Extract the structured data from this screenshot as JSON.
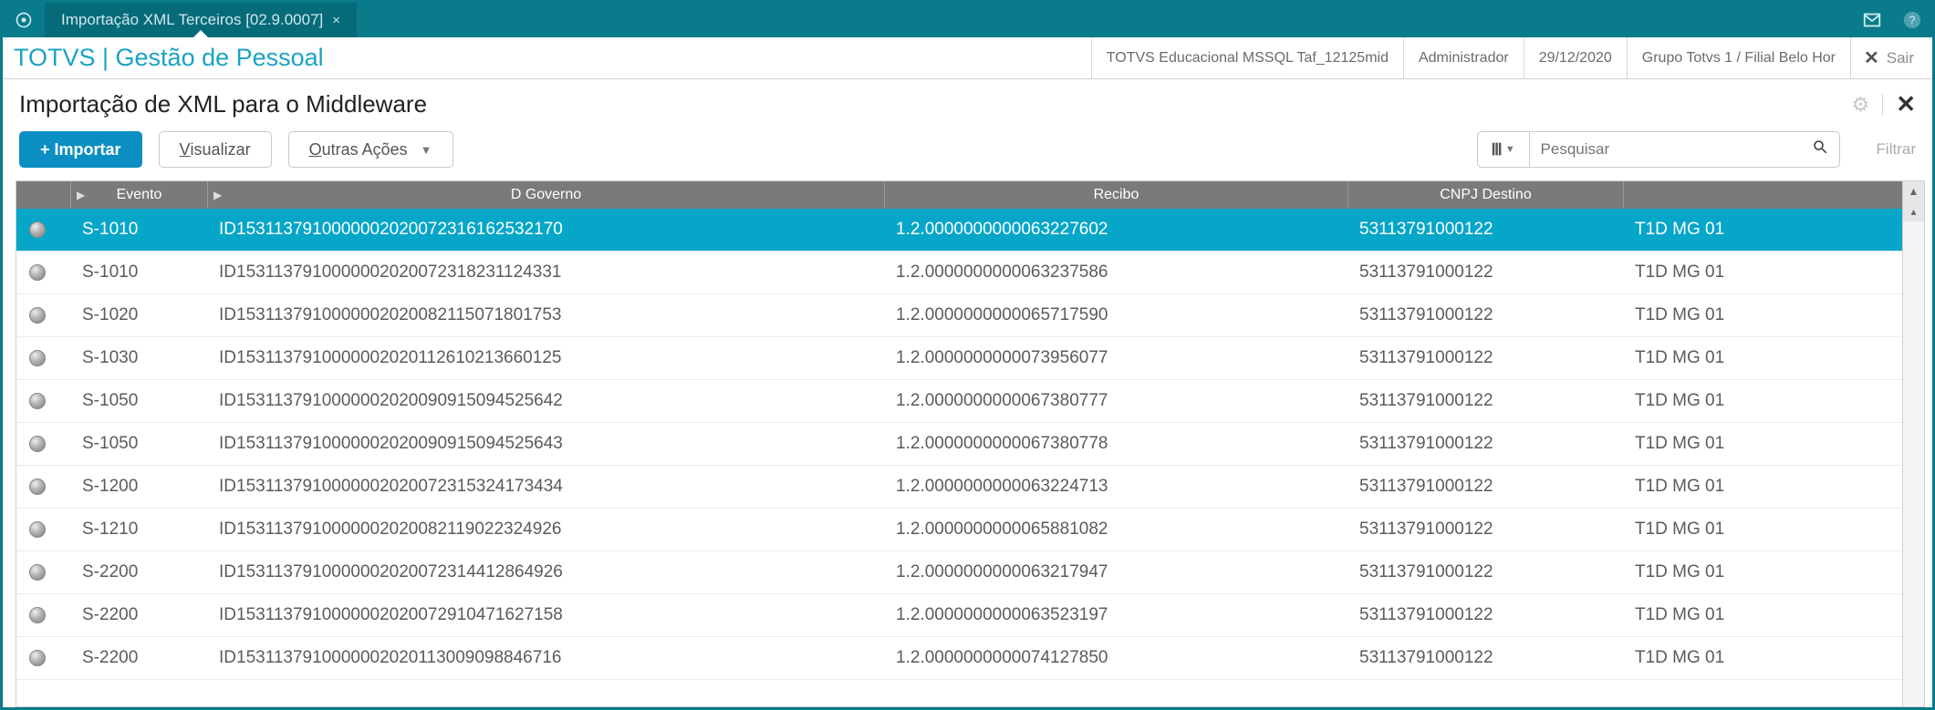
{
  "titlebar": {
    "tab_label": "Importação XML Terceiros [02.9.0007]"
  },
  "modulebar": {
    "title": "TOTVS | Gestão de Pessoal",
    "crumbs": [
      "TOTVS Educacional MSSQL Taf_12125mid",
      "Administrador",
      "29/12/2020",
      "Grupo Totvs 1 / Filial Belo Hor"
    ],
    "exit_label": "Sair"
  },
  "page": {
    "title": "Importação de XML para o Middleware"
  },
  "toolbar": {
    "import_label": "+ Importar",
    "visualizar_u": "V",
    "visualizar_rest": "isualizar",
    "outras_u": "O",
    "outras_rest": "utras Ações",
    "search_placeholder": "Pesquisar",
    "filtrar_label": "Filtrar"
  },
  "columns": {
    "evento": "Evento",
    "gov": "D Governo",
    "recibo": "Recibo",
    "cnpj": "CNPJ Destino"
  },
  "rows": [
    {
      "evento": "S-1010",
      "gov": "ID1531137910000002020072316162532170",
      "recibo": "1.2.0000000000063227602",
      "cnpj": "53113791000122",
      "extra": "T1D MG 01",
      "sel": true
    },
    {
      "evento": "S-1010",
      "gov": "ID1531137910000002020072318231124331",
      "recibo": "1.2.0000000000063237586",
      "cnpj": "53113791000122",
      "extra": "T1D MG 01",
      "sel": false
    },
    {
      "evento": "S-1020",
      "gov": "ID1531137910000002020082115071801753",
      "recibo": "1.2.0000000000065717590",
      "cnpj": "53113791000122",
      "extra": "T1D MG 01",
      "sel": false
    },
    {
      "evento": "S-1030",
      "gov": "ID1531137910000002020112610213660125",
      "recibo": "1.2.0000000000073956077",
      "cnpj": "53113791000122",
      "extra": "T1D MG 01",
      "sel": false
    },
    {
      "evento": "S-1050",
      "gov": "ID1531137910000002020090915094525642",
      "recibo": "1.2.0000000000067380777",
      "cnpj": "53113791000122",
      "extra": "T1D MG 01",
      "sel": false
    },
    {
      "evento": "S-1050",
      "gov": "ID1531137910000002020090915094525643",
      "recibo": "1.2.0000000000067380778",
      "cnpj": "53113791000122",
      "extra": "T1D MG 01",
      "sel": false
    },
    {
      "evento": "S-1200",
      "gov": "ID1531137910000002020072315324173434",
      "recibo": "1.2.0000000000063224713",
      "cnpj": "53113791000122",
      "extra": "T1D MG 01",
      "sel": false
    },
    {
      "evento": "S-1210",
      "gov": "ID1531137910000002020082119022324926",
      "recibo": "1.2.0000000000065881082",
      "cnpj": "53113791000122",
      "extra": "T1D MG 01",
      "sel": false
    },
    {
      "evento": "S-2200",
      "gov": "ID1531137910000002020072314412864926",
      "recibo": "1.2.0000000000063217947",
      "cnpj": "53113791000122",
      "extra": "T1D MG 01",
      "sel": false
    },
    {
      "evento": "S-2200",
      "gov": "ID1531137910000002020072910471627158",
      "recibo": "1.2.0000000000063523197",
      "cnpj": "53113791000122",
      "extra": "T1D MG 01",
      "sel": false
    },
    {
      "evento": "S-2200",
      "gov": "ID1531137910000002020113009098846716",
      "recibo": "1.2.0000000000074127850",
      "cnpj": "53113791000122",
      "extra": "T1D MG 01",
      "sel": false
    }
  ]
}
